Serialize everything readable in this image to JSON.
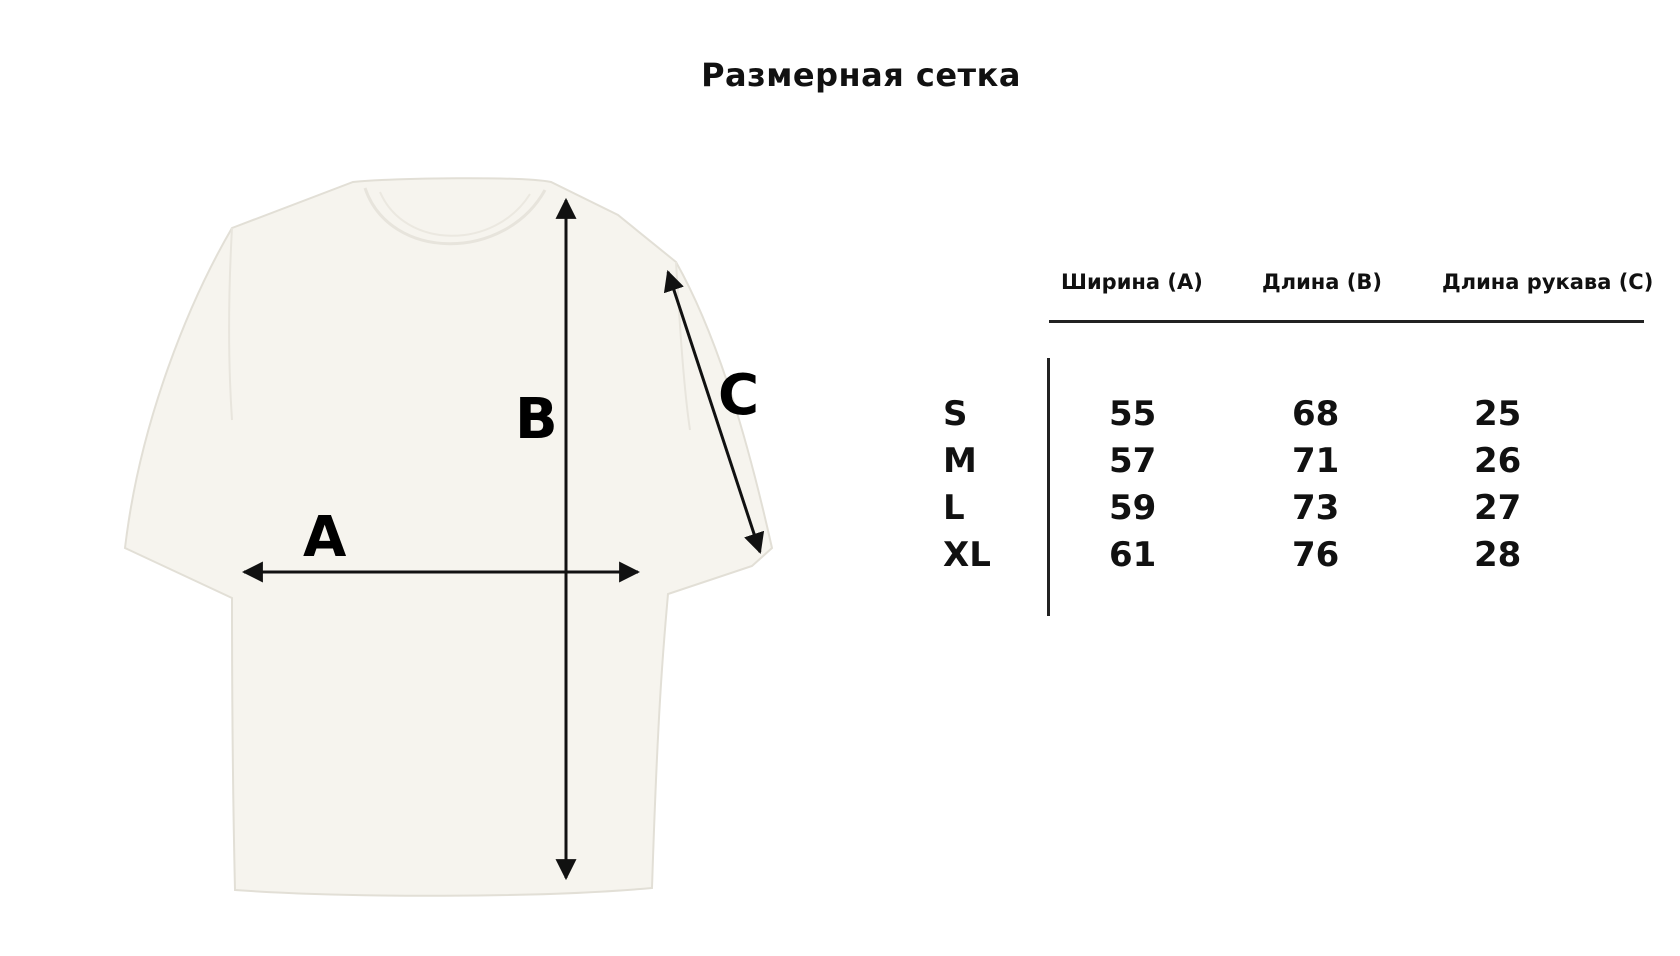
{
  "title": "Размерная сетка",
  "diagram": {
    "labels": {
      "a": "A",
      "b": "B",
      "c": "C"
    }
  },
  "table": {
    "headers": [
      "Ширина (A)",
      "Длина (B)",
      "Длина рукава (C)"
    ],
    "rows": [
      {
        "size": "S",
        "width": "55",
        "length": "68",
        "sleeve": "25"
      },
      {
        "size": "M",
        "width": "57",
        "length": "71",
        "sleeve": "26"
      },
      {
        "size": "L",
        "width": "59",
        "length": "73",
        "sleeve": "27"
      },
      {
        "size": "XL",
        "width": "61",
        "length": "76",
        "sleeve": "28"
      }
    ]
  },
  "colors": {
    "shirt": "#f6f4ee",
    "text": "#111111"
  }
}
